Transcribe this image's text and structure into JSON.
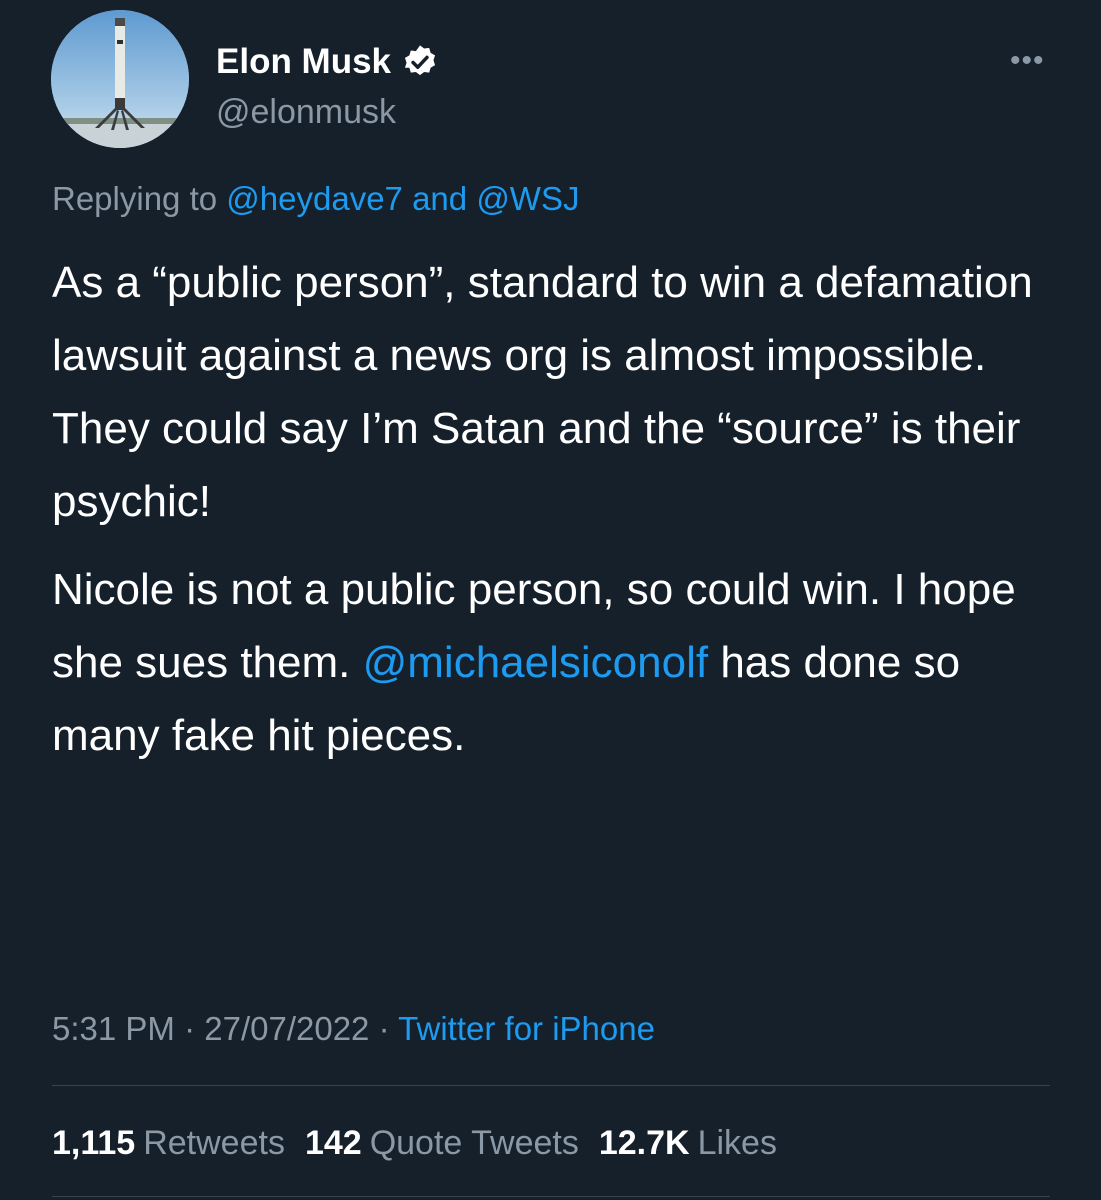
{
  "author": {
    "display_name": "Elon Musk",
    "handle": "@elonmusk",
    "verified": true
  },
  "menu": {
    "more_label": "•••"
  },
  "reply": {
    "prefix": "Replying to",
    "target1": "@heydave7",
    "joiner": "and",
    "target2": "@WSJ"
  },
  "tweet": {
    "paragraph1": "As a “public person”, standard to win a defamation lawsuit against a news org is almost impossible. They could say I’m Satan and the “source” is their psychic!",
    "paragraph2_before": "Nicole is not a public person, so could win. I hope she sues them.",
    "paragraph2_mention": "@michaelsiconolf",
    "paragraph2_after": "has done so many fake hit pieces."
  },
  "meta": {
    "time": "5:31 PM",
    "separator": "·",
    "date": "27/07/2022",
    "source": "Twitter for iPhone"
  },
  "stats": {
    "retweets_count": "1,115",
    "retweets_label": "Retweets",
    "quotes_count": "142",
    "quotes_label": "Quote Tweets",
    "likes_count": "12.7K",
    "likes_label": "Likes"
  },
  "colors": {
    "background": "#15202b",
    "text_primary": "#ffffff",
    "text_secondary": "#8b98a5",
    "accent_link": "#1d9bf0",
    "divider": "#38444d"
  }
}
